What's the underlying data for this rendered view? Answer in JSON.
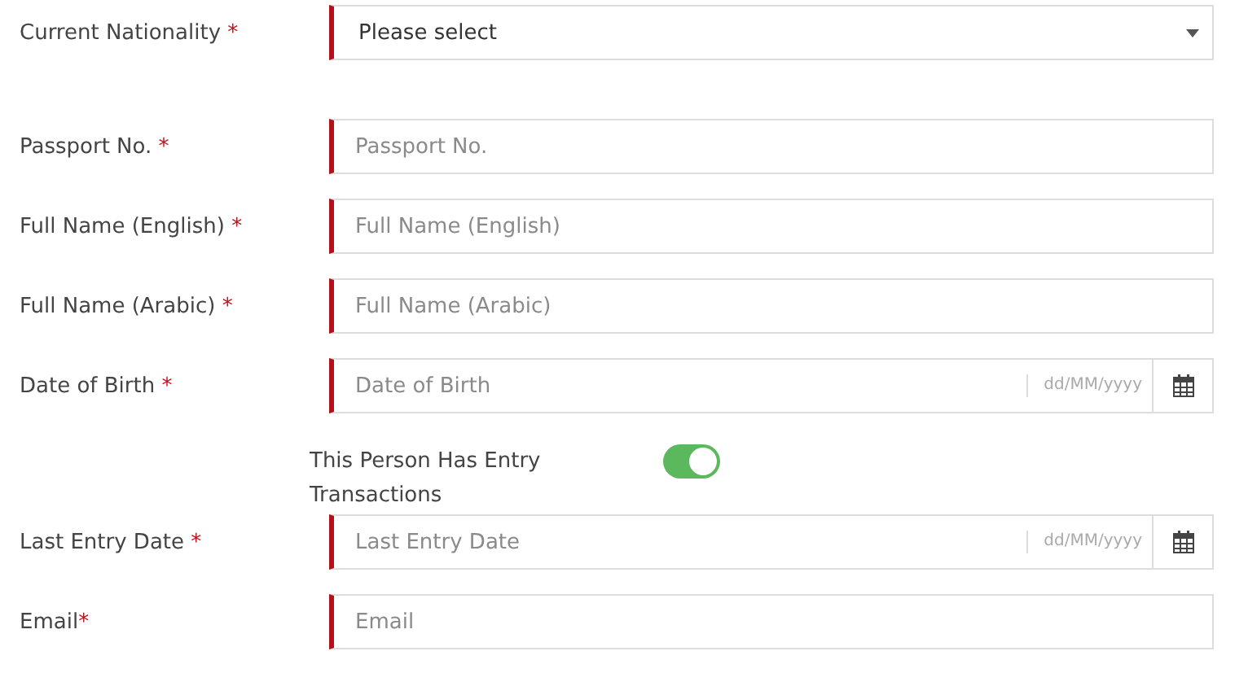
{
  "fields": [
    {
      "kind": "select",
      "label": "Current Nationality",
      "required_mark": " *",
      "value": "Please select"
    },
    {
      "kind": "text",
      "label": "Passport No.",
      "required_mark": " *",
      "placeholder": "Passport No."
    },
    {
      "kind": "text",
      "label": "Full Name (English)",
      "required_mark": " *",
      "placeholder": "Full Name (English)"
    },
    {
      "kind": "text",
      "label": "Full Name (Arabic)",
      "required_mark": " *",
      "placeholder": "Full Name (Arabic)"
    },
    {
      "kind": "date",
      "label": "Date of Birth",
      "required_mark": " *",
      "placeholder": "Date of Birth",
      "format": "dd/MM/yyyy"
    },
    {
      "kind": "toggle",
      "label": "This Person Has Entry Transactions",
      "on": true
    },
    {
      "kind": "date",
      "label": "Last Entry Date",
      "required_mark": " *",
      "placeholder": "Last Entry Date",
      "format": "dd/MM/yyyy"
    },
    {
      "kind": "text",
      "label": "Email",
      "required_mark": "*",
      "placeholder": "Email"
    }
  ]
}
